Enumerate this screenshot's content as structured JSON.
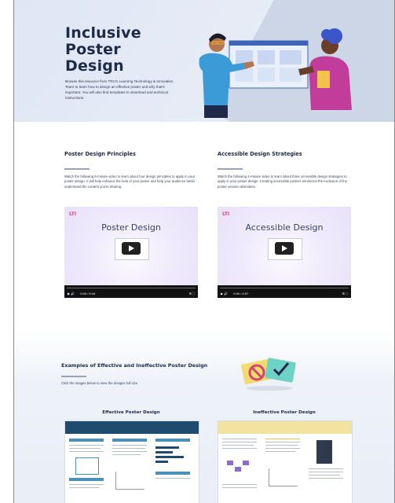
{
  "hero": {
    "title_lines": [
      "Inclusive",
      "Poster",
      "Design"
    ],
    "description": "Browse this resource from TRU's Learning Technology & Innovation Team to learn how to design an effective poster and why that's important. You will also find templates to download and technical instructions."
  },
  "principles": {
    "title": "Poster Design Principles",
    "body": "Watch the following 6-minute video to learn about four design principles to apply in your poster design. It will help enhance the look of your poster and help your audience better understand the content you're sharing.",
    "video": {
      "logo": "LTI",
      "title": "Poster Design",
      "time": "0:00 / 6:16",
      "left_controls": "▶  🔊",
      "right_controls": "⚙  ⛶"
    }
  },
  "accessible": {
    "title": "Accessible Design Strategies",
    "body": "Watch the following 4-minute video to learn about three accessible design strategies to apply in your poster design. Creating accessible posters minimizes the exclusion of the poster session attendees.",
    "video": {
      "logo": "LTI",
      "title": "Accessible  Design",
      "time": "0:00 / 4:07",
      "left_controls": "▶  🔊",
      "right_controls": "⚙  ⛶"
    }
  },
  "examples": {
    "title": "Examples of Effective and Ineffective Poster Design",
    "description": "Click the images below to view the designs full size.",
    "effective_label": "Effective Poster Design",
    "ineffective_label": "Ineffective Poster Design"
  },
  "colors": {
    "accent_navy": "#1e2a4a",
    "effective_header": "#1f4b6e",
    "ineffective_header": "#f3e3a0",
    "logo_pink": "#e0457b"
  }
}
